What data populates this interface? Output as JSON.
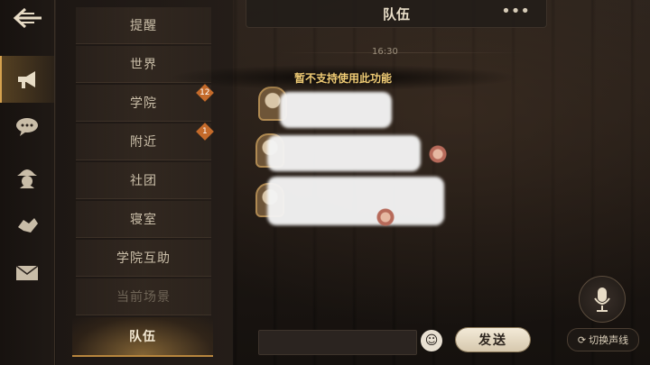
{
  "header": {
    "title": "队伍",
    "more_icon": "more-dots-icon"
  },
  "rail": {
    "back_icon": "back-arrow-icon",
    "items": [
      {
        "icon": "megaphone-icon",
        "active": true
      },
      {
        "icon": "chat-bubbles-icon",
        "active": false
      },
      {
        "icon": "detective-hat-icon",
        "active": false
      },
      {
        "icon": "handshake-icon",
        "active": false
      },
      {
        "icon": "envelope-icon",
        "active": false
      }
    ]
  },
  "channels": {
    "items": [
      {
        "label": "提醒"
      },
      {
        "label": "世界"
      },
      {
        "label": "学院",
        "badge": "12"
      },
      {
        "label": "附近",
        "badge": "1"
      },
      {
        "label": "社团"
      },
      {
        "label": "寝室"
      },
      {
        "label": "学院互助"
      },
      {
        "label": "当前场景",
        "disabled": true
      },
      {
        "label": "队伍",
        "active": true
      }
    ]
  },
  "chat": {
    "timestamp": "16:30",
    "toast": "暂不支持使用此功能"
  },
  "composer": {
    "input_value": "",
    "emoji_icon": "smiley-icon",
    "send_label": "发送"
  },
  "voice": {
    "mic_icon": "microphone-icon",
    "switch_icon": "refresh-icon",
    "switch_label": "切换声线"
  },
  "colors": {
    "accent": "#d6a24f",
    "toast": "#f0cc75",
    "badge": "#c46a2a"
  }
}
